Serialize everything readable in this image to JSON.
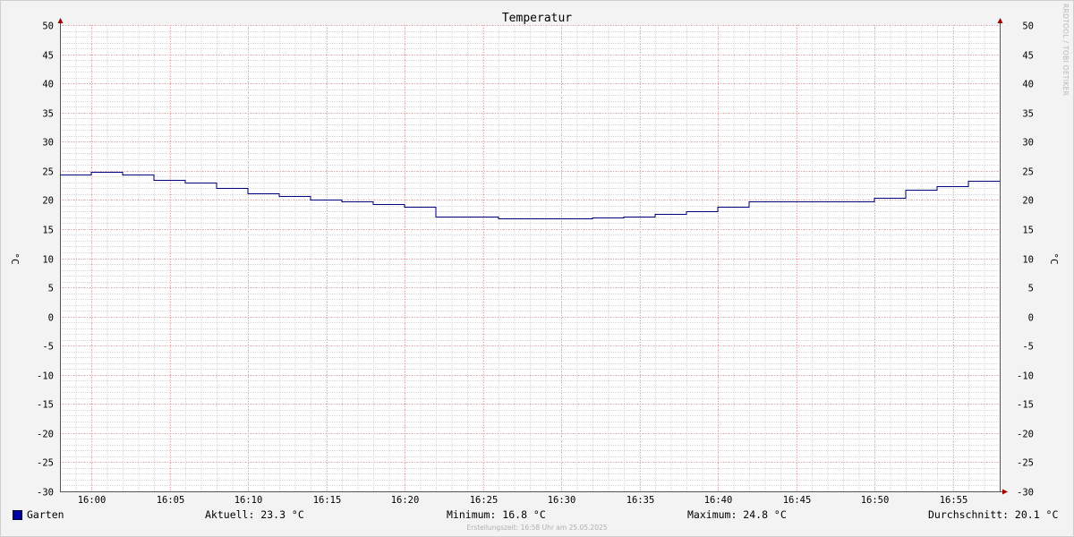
{
  "chart_data": {
    "type": "line",
    "title": "Temperatur",
    "ylabel": "°C",
    "ylabel_right": "°C",
    "xlabel": "",
    "ylim": [
      -30,
      50
    ],
    "yticks": [
      50,
      45,
      40,
      35,
      30,
      25,
      20,
      15,
      10,
      5,
      0,
      -5,
      -10,
      -15,
      -20,
      -25,
      -30
    ],
    "xticks": [
      "16:00",
      "16:05",
      "16:10",
      "16:15",
      "16:20",
      "16:25",
      "16:30",
      "16:35",
      "16:40",
      "16:45",
      "16:50",
      "16:55"
    ],
    "grid": true,
    "step": true,
    "series": [
      {
        "name": "Garten",
        "color": "#000080",
        "x": [
          "15:58",
          "16:00",
          "16:02",
          "16:04",
          "16:06",
          "16:08",
          "16:10",
          "16:12",
          "16:14",
          "16:16",
          "16:18",
          "16:20",
          "16:22",
          "16:24",
          "16:26",
          "16:28",
          "16:30",
          "16:32",
          "16:34",
          "16:36",
          "16:38",
          "16:40",
          "16:42",
          "16:44",
          "16:46",
          "16:48",
          "16:50",
          "16:52",
          "16:54",
          "16:56",
          "16:58"
        ],
        "values": [
          24.3,
          24.8,
          24.3,
          23.4,
          22.9,
          22.0,
          21.2,
          20.6,
          20.1,
          19.7,
          19.3,
          18.8,
          17.2,
          17.2,
          16.8,
          16.8,
          16.8,
          17.0,
          17.2,
          17.6,
          18.0,
          18.8,
          19.7,
          19.7,
          19.7,
          19.7,
          20.4,
          21.8,
          22.4,
          23.3,
          23.3
        ]
      }
    ],
    "legend_position": "bottom-left"
  },
  "legend": {
    "series_name": "Garten",
    "aktuell": "Aktuell: 23.3 °C",
    "minimum": "Minimum: 16.8 °C",
    "maximum": "Maximum: 24.8 °C",
    "durchschnitt": "Durchschnitt: 20.1 °C"
  },
  "footer": "Erstellungszeit: 16:58 Uhr am 25.05.2025",
  "watermark": "RRDTOOL / TOBI OETIKER"
}
